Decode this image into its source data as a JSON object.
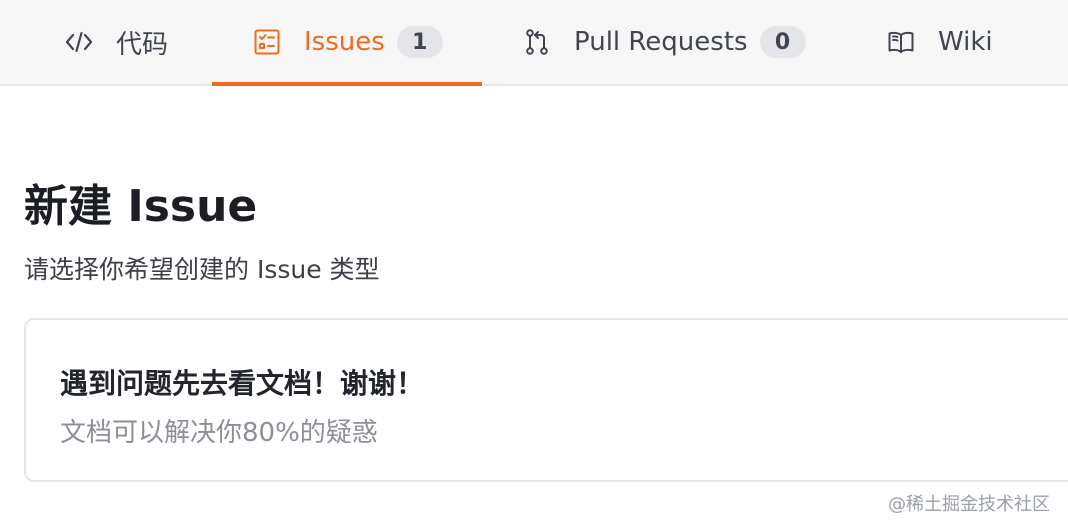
{
  "tabs": {
    "code": {
      "label": "代码",
      "icon": "code-icon"
    },
    "issues": {
      "label": "Issues",
      "count": "1",
      "icon": "issues-icon",
      "active": true
    },
    "pull_requests": {
      "label": "Pull Requests",
      "count": "0",
      "icon": "pull-request-icon"
    },
    "wiki": {
      "label": "Wiki",
      "icon": "book-icon"
    }
  },
  "page": {
    "title": "新建 Issue",
    "subtitle": "请选择你希望创建的 Issue 类型"
  },
  "templates": [
    {
      "title": "遇到问题先去看文档！谢谢！",
      "description": "文档可以解决你80%的疑惑"
    }
  ],
  "watermark": "@稀土掘金技术社区",
  "colors": {
    "accent": "#f06a1f",
    "tab_bar_bg": "#f6f6f6",
    "badge_bg": "#e3e5e8",
    "muted_text": "#8b9097"
  }
}
